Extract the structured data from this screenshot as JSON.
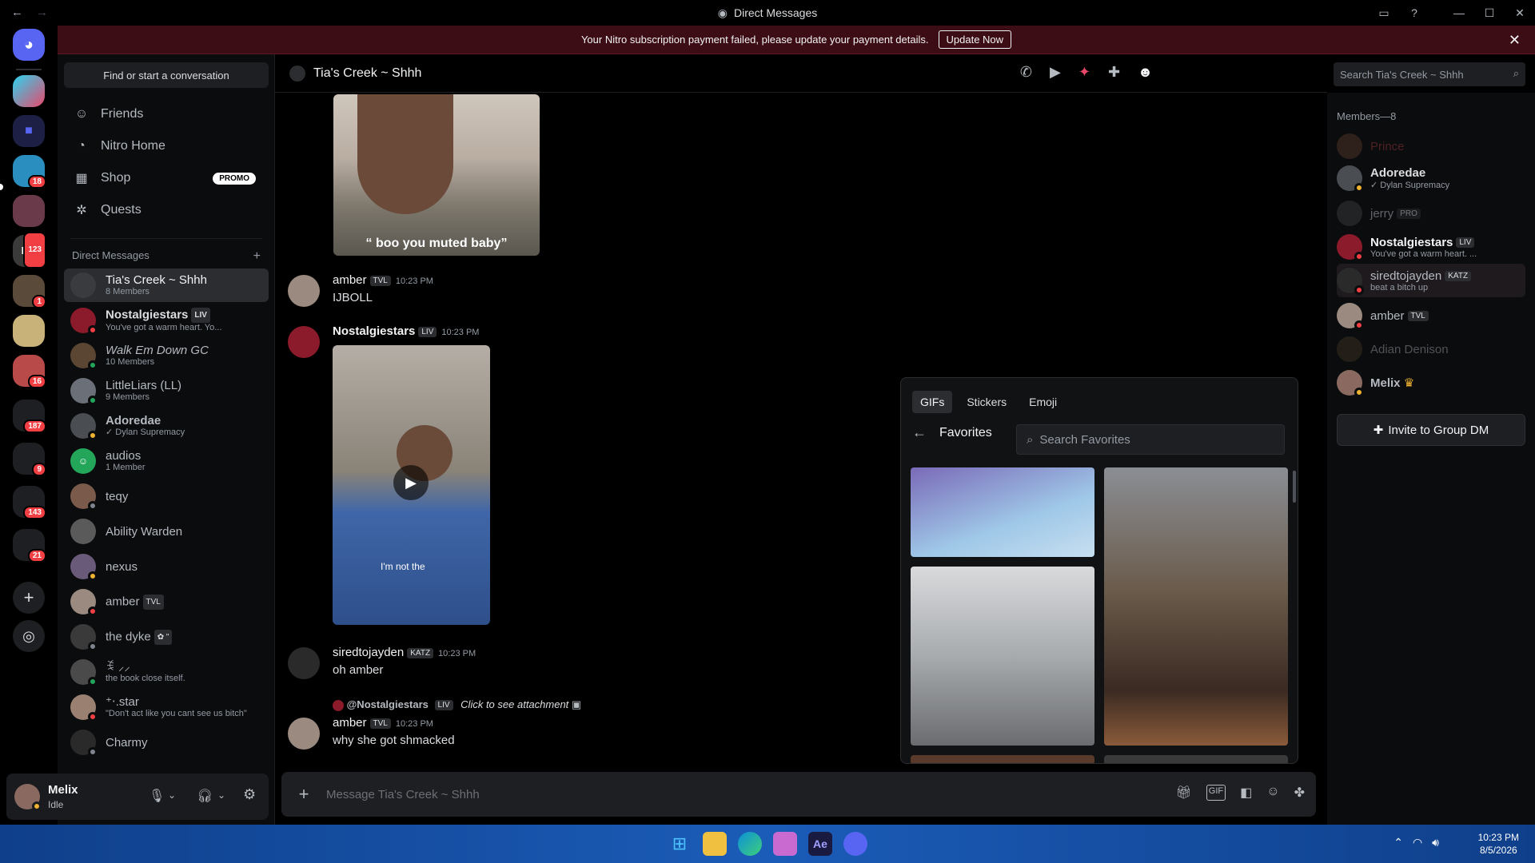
{
  "window": {
    "title": "Direct Messages"
  },
  "banner": {
    "text": "Your Nitro subscription payment failed, please update your payment details.",
    "button": "Update Now"
  },
  "servers": {
    "badges": [
      "18",
      "123",
      "1",
      "16",
      "187",
      "9",
      "143",
      "21"
    ]
  },
  "sidebar": {
    "find_placeholder": "Find or start a conversation",
    "nav": [
      {
        "label": "Friends"
      },
      {
        "label": "Nitro Home"
      },
      {
        "label": "Shop",
        "badge": "PROMO"
      },
      {
        "label": "Quests"
      }
    ],
    "dm_header": "Direct Messages",
    "dms": [
      {
        "name": "Tia's Creek ~ Shhh",
        "sub": "8 Members",
        "color": "#3a3b3f"
      },
      {
        "name": "Nostalgiestars",
        "tag": "LIV",
        "sub": "You've got a warm heart. Yo...",
        "color": "#8b1a2a"
      },
      {
        "name": "Walk Em Down GC",
        "sub": "10 Members",
        "color": "#5a4632"
      },
      {
        "name": "LittleLiars (LL)",
        "sub": "9 Members",
        "color": "#6b6f78"
      },
      {
        "name": "Adoredae",
        "sub": "Dylan Supremacy",
        "color": "#4a4d52"
      },
      {
        "name": "audios",
        "sub": "1 Member",
        "color": "#23a55a"
      },
      {
        "name": "teqy",
        "sub": "",
        "color": "#7a5a4a"
      },
      {
        "name": "Ability Warden",
        "sub": "",
        "color": "#5a5a5a"
      },
      {
        "name": "nexus",
        "sub": "",
        "color": "#6a5a7a"
      },
      {
        "name": "amber",
        "tag": "TVL",
        "sub": "",
        "color": "#9a8a80"
      },
      {
        "name": "the dyke",
        "sub": "",
        "color": "#3a3a3a"
      },
      {
        "name": "ꉂ ⸝⸝",
        "sub": "the book close itself.",
        "color": "#4a4a4a"
      },
      {
        "name": "⁺‧.star",
        "sub": "\"Don't act like you cant see us bitch\"",
        "color": "#9a8070"
      },
      {
        "name": "Charmy",
        "sub": "",
        "color": "#2a2a2a"
      }
    ]
  },
  "user": {
    "name": "Melix",
    "status": "Idle"
  },
  "chat": {
    "title": "Tia's Creek ~ Shhh",
    "search_placeholder": "Search Tia's Creek ~ Shhh",
    "image_caption": "“ boo you muted baby”",
    "video_caption": "I'm not the",
    "messages": [
      {
        "author": "amber",
        "tag": "TVL",
        "time": "10:23 PM",
        "text": "IJBOLL"
      },
      {
        "author": "Nostalgiestars",
        "tag": "LIV",
        "time": "10:23 PM",
        "text": ""
      },
      {
        "author": "siredtojayden",
        "tag": "KATZ",
        "time": "10:23 PM",
        "text": "oh amber"
      },
      {
        "author": "amber",
        "tag": "TVL",
        "time": "10:23 PM",
        "text": "why she got shmacked",
        "reply_to": "@Nostalgiestars",
        "reply_tag": "LIV",
        "reply_text": "Click to see attachment"
      }
    ],
    "composer_placeholder": "Message Tia's Creek ~ Shhh"
  },
  "members": {
    "header": "Members—8",
    "list": [
      {
        "name": "Prince",
        "sub": "",
        "color": "#5a3a2a",
        "name_color": "#6a2a2a"
      },
      {
        "name": "Adoredae",
        "sub": "Dylan Supremacy",
        "color": "#4a4d52",
        "name_color": "#dbdee1"
      },
      {
        "name": "jerry",
        "tag": "PRO",
        "sub": "",
        "color": "#3a3a3a",
        "name_color": "#4e5058"
      },
      {
        "name": "Nostalgiestars",
        "tag": "LIV",
        "sub": "You've got a warm heart. ...",
        "color": "#8b1a2a",
        "name_color": "#f2f3f5"
      },
      {
        "name": "siredtojayden",
        "tag": "KATZ",
        "sub": "beat a bitch up",
        "color": "#2a2a2a",
        "name_color": "#b5bac1"
      },
      {
        "name": "amber",
        "tag": "TVL",
        "sub": "",
        "color": "#9a8a80",
        "name_color": "#b5bac1"
      },
      {
        "name": "Adian Denison",
        "sub": "",
        "color": "#4a3a2a",
        "name_color": "#4e5058"
      },
      {
        "name": "Melix",
        "sub": "",
        "color": "#8a6a60",
        "name_color": "#b5bac1"
      }
    ],
    "invite": "Invite to Group DM"
  },
  "picker": {
    "tabs": [
      "GIFs",
      "Stickers",
      "Emoji"
    ],
    "section": "Favorites",
    "search_placeholder": "Search Favorites"
  },
  "taskbar": {
    "time": "10:23 PM",
    "date": "8/5/2026"
  }
}
